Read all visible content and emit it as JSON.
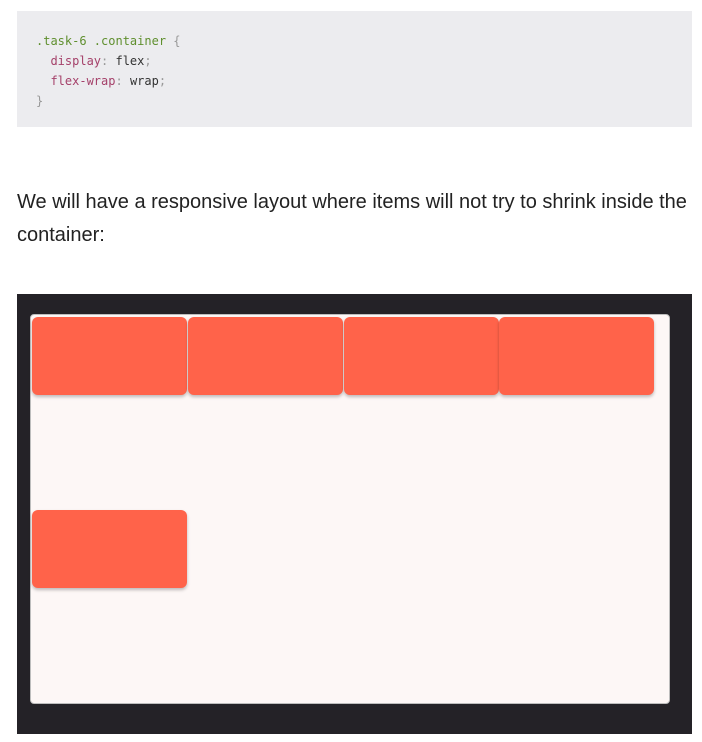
{
  "code": {
    "selector": ".task-6 .container",
    "open_brace": " {",
    "close_brace": "}",
    "declarations": [
      {
        "property": "display",
        "value": "flex"
      },
      {
        "property": "flex-wrap",
        "value": "wrap"
      }
    ]
  },
  "paragraph": {
    "text": "We will have a responsive layout where items will not try to shrink inside the container:"
  },
  "demo": {
    "item_color": "#ff634a",
    "frame_color": "#242227",
    "container_color": "#fdf7f6",
    "item_count": 5
  }
}
